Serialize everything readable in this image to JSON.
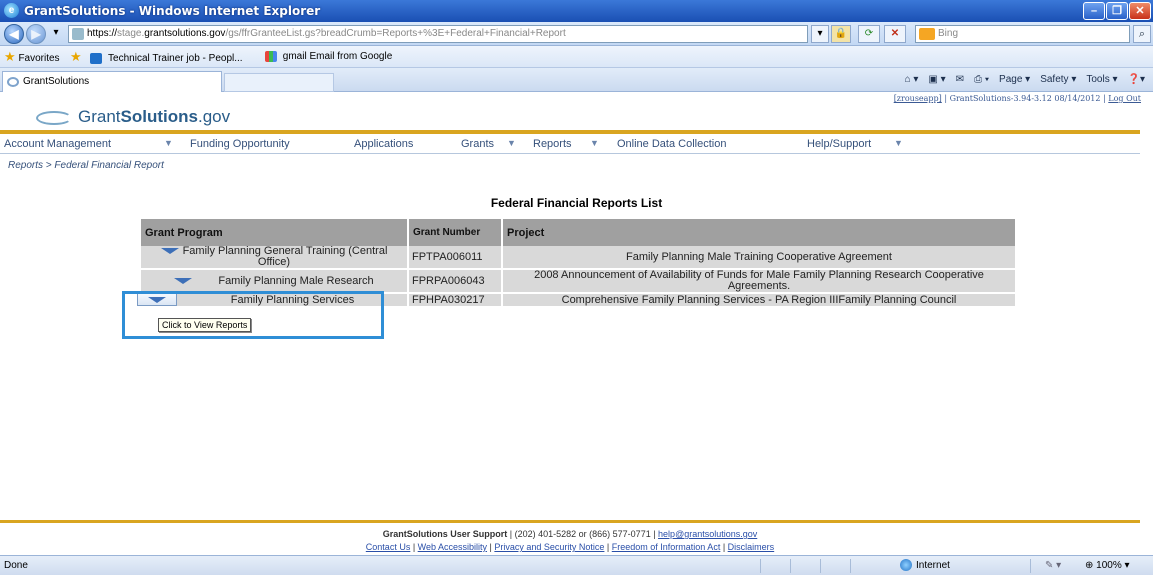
{
  "window": {
    "title": "GrantSolutions - Windows Internet Explorer"
  },
  "address_bar": {
    "url_scheme": "https://",
    "url_host_prefix": "stage.",
    "url_host": "grantsolutions.gov",
    "url_path": "/gs/ffrGranteeList.gs?breadCrumb=Reports+%3E+Federal+Financial+Report",
    "search_placeholder": "Bing"
  },
  "favorites_bar": {
    "favorites_label": "Favorites",
    "items": [
      {
        "label": "Technical Trainer job - Peopl..."
      },
      {
        "label": "gmail Email from Google"
      }
    ]
  },
  "tabs": [
    {
      "label": "GrantSolutions"
    }
  ],
  "command_bar": {
    "page": "Page ▾",
    "safety": "Safety ▾",
    "tools": "Tools ▾",
    "help": "❓▾"
  },
  "site": {
    "logo_regular": "Grant",
    "logo_bold": "Solutions",
    "logo_suffix": ".gov",
    "user_link": "[zrouseapp]",
    "version": "GrantSolutions-3.94-3.12 08/14/2012",
    "logout": "Log Out",
    "menu": [
      {
        "label": "Account Management"
      },
      {
        "label": "Funding Opportunity"
      },
      {
        "label": "Applications"
      },
      {
        "label": "Grants"
      },
      {
        "label": "Reports"
      },
      {
        "label": "Online Data Collection"
      },
      {
        "label": "Help/Support"
      }
    ],
    "breadcrumb": "Reports > Federal Financial Report"
  },
  "reports_list": {
    "title": "Federal Financial Reports List",
    "columns": {
      "program": "Grant Program",
      "grant_number": "Grant Number",
      "project": "Project"
    },
    "rows": [
      {
        "program": "Family Planning General Training (Central Office)",
        "grant_number": "FPTPA006011",
        "project": "Family Planning Male Training Cooperative Agreement"
      },
      {
        "program": "Family Planning Male Research",
        "grant_number": "FPRPA006043",
        "project": "2008 Announcement of Availability of Funds for Male Family Planning Research Cooperative Agreements."
      },
      {
        "program": "Family Planning Services",
        "grant_number": "FPHPA030217",
        "project": "Comprehensive Family Planning Services - PA Region IIIFamily Planning Council"
      }
    ],
    "tooltip": "Click to View Reports"
  },
  "footer": {
    "support_label": "GrantSolutions User Support",
    "support_info": " | (202) 401-5282 or (866) 577-0771 | ",
    "email": "help@grantsolutions.gov",
    "links": [
      "Contact Us",
      "Web Accessibility",
      "Privacy and Security Notice",
      "Freedom of Information Act",
      "Disclaimers"
    ]
  },
  "status_bar": {
    "status": "Done",
    "zone": "Internet",
    "zoom": "100%"
  },
  "colors": {
    "accent_gold": "#d9a520",
    "table_header": "#a0a0a0",
    "table_row": "#d9d9d9",
    "highlight": "#2f8ed6",
    "link": "#2a4fa8"
  }
}
